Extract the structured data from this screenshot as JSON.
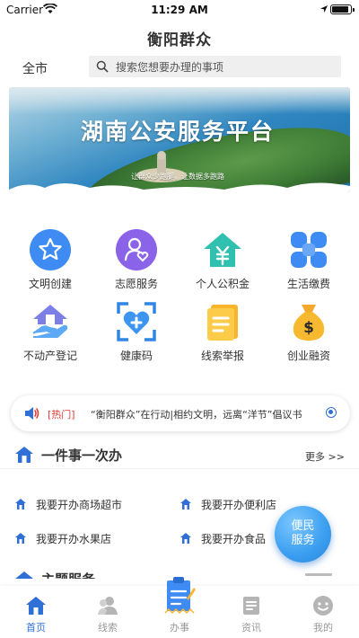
{
  "status_bar": {
    "carrier": "Carrier",
    "time": "11:29 AM"
  },
  "header": {
    "title": "衡阳群众"
  },
  "search": {
    "city": "全市",
    "placeholder": "搜索您想要办理的事项"
  },
  "banner": {
    "title": "湖南公安服务平台",
    "slogan": "让群众少跑腿，让数据多跑路"
  },
  "services": [
    {
      "label": "文明创建",
      "icon": "star-badge-icon"
    },
    {
      "label": "志愿服务",
      "icon": "volunteer-heart-icon"
    },
    {
      "label": "个人公积金",
      "icon": "housing-fund-icon"
    },
    {
      "label": "生活缴费",
      "icon": "life-payment-icon"
    },
    {
      "label": "不动产登记",
      "icon": "real-estate-icon"
    },
    {
      "label": "健康码",
      "icon": "health-code-icon"
    },
    {
      "label": "线索举报",
      "icon": "clue-report-icon"
    },
    {
      "label": "创业融资",
      "icon": "money-bag-icon"
    }
  ],
  "notice": {
    "tag": "[热门]",
    "text": "“衡阳群众”在行动|相约文明，远离“洋节”倡议书"
  },
  "one_thing": {
    "title": "一件事一次办",
    "more": "更多 >>",
    "items": [
      "我要开办商场超市",
      "我要开办便利店",
      "我要开办水果店",
      "我要开办食品"
    ]
  },
  "next_section": {
    "title": "主题服务"
  },
  "float_button": {
    "line1": "便民",
    "line2": "服务"
  },
  "tabs": [
    {
      "label": "首页",
      "active": true
    },
    {
      "label": "线索",
      "active": false
    },
    {
      "label": "办事",
      "active": false
    },
    {
      "label": "资讯",
      "active": false
    },
    {
      "label": "我的",
      "active": false
    }
  ],
  "colors": {
    "accent": "#2f6fd6",
    "hot": "#e53935",
    "float": "#3a9ef0"
  }
}
